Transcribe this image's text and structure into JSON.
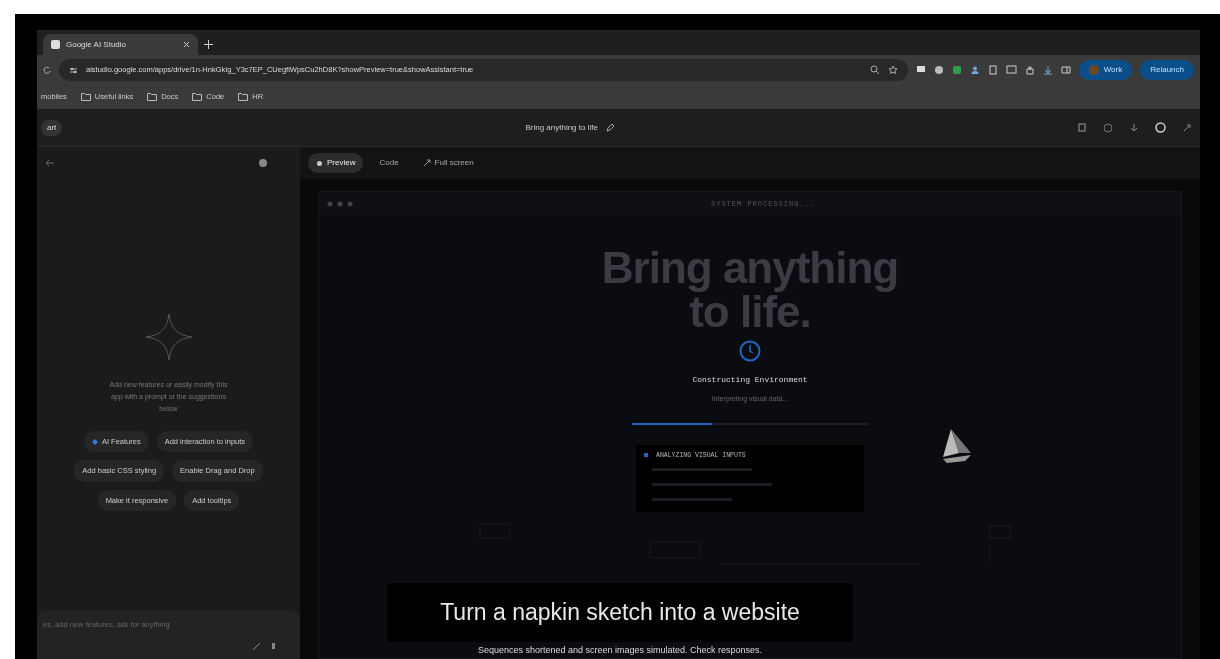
{
  "browser": {
    "tabs": [
      {
        "title": "Google AI Studio",
        "selected": true
      }
    ],
    "url": "aistudio.google.com/apps/drive/1n-HnkGkIg_Y3c7EP_CUegfiWpsCu2hD8K?showPreview=true&showAssistant=true",
    "profile": "Work",
    "update_button": "Relaunch",
    "bookmarks": [
      {
        "label": "mobiles",
        "kind": "text"
      },
      {
        "label": "Useful links",
        "kind": "folder"
      },
      {
        "label": "Docs",
        "kind": "folder"
      },
      {
        "label": "Code",
        "kind": "folder"
      },
      {
        "label": "HR",
        "kind": "folder"
      }
    ]
  },
  "app": {
    "header": {
      "start_button": "art",
      "title": "Bring anything to life"
    },
    "assistant": {
      "intro": "Add new features or easily modify this app with a prompt or the suggestions below",
      "suggestions": [
        {
          "label": "AI Features",
          "kind": "featured"
        },
        {
          "label": "Add interaction to inputs",
          "kind": "plain"
        },
        {
          "label": "Add basic CSS styling",
          "kind": "plain"
        },
        {
          "label": "Enable Drag and Drop",
          "kind": "plain"
        },
        {
          "label": "Make it responsive",
          "kind": "plain"
        },
        {
          "label": "Add tooltips",
          "kind": "plain"
        }
      ],
      "input_placeholder": "es, add new features, ask for anything"
    },
    "preview": {
      "tabs": [
        {
          "label": "Preview",
          "selected": true
        },
        {
          "label": "Code",
          "selected": false
        },
        {
          "label": "Full screen",
          "selected": false
        }
      ],
      "window_title": "SYSTEM PROCESSING...",
      "headline": "Bring anything to life.",
      "status": "Constructing Environment",
      "substatus": "Interpreting visual data...",
      "progress": {
        "level": 0.34
      },
      "log_heading": "ANALYZING VISUAL INPUTS"
    }
  },
  "caption": {
    "title": "Turn a napkin sketch into a website",
    "note": "Sequences shortened and screen images simulated. Check responses."
  }
}
